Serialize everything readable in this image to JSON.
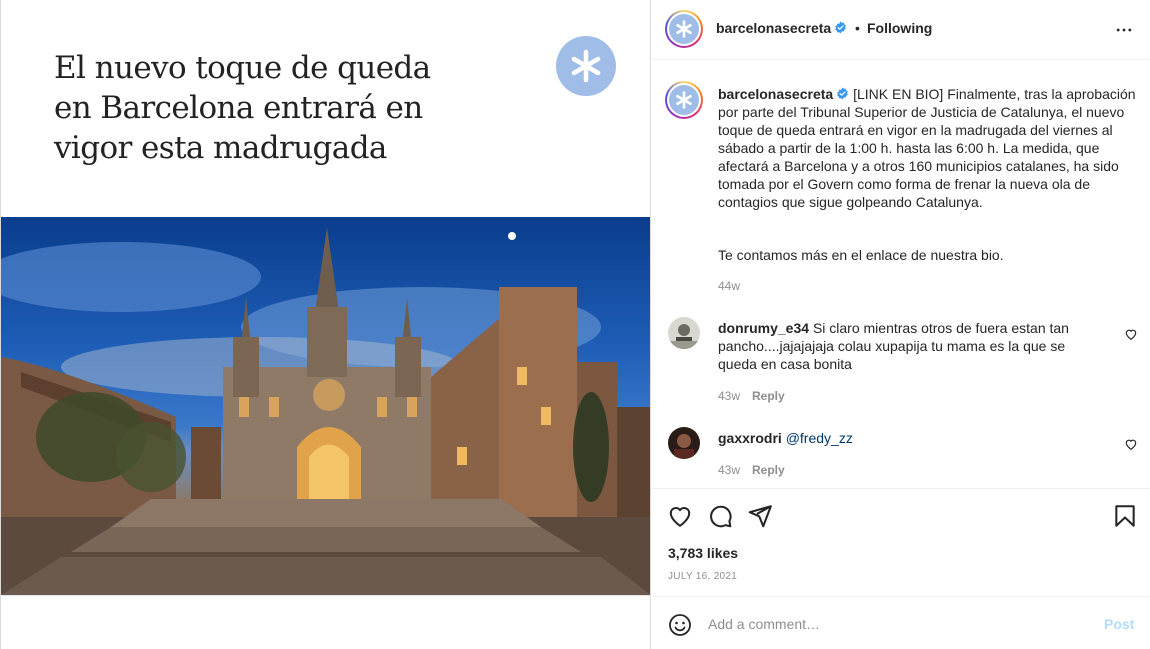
{
  "media": {
    "headline_lines": [
      "El nuevo toque de queda",
      "en Barcelona entrará en",
      "vigor esta madrugada"
    ],
    "logo_icon": "asterisk-logo-icon",
    "photo_subject": "cathedral-photo"
  },
  "post": {
    "author": "barcelonasecreta",
    "verified": true,
    "follow_separator": "•",
    "follow_status": "Following",
    "more_icon": "more-options-icon"
  },
  "caption": {
    "author": "barcelonasecreta",
    "text": "[LINK EN BIO] Finalmente, tras la aprobación por parte del Tribunal Superior de Justicia de Catalunya, el nuevo toque de queda entrará en vigor en la madrugada del viernes al sábado a partir de la 1:00 h. hasta las 6:00 h. La medida, que afectará a Barcelona y a otros 160 municipios catalanes, ha sido tomada por el Govern como forma de frenar la nueva ola de contagios que sigue golpeando Catalunya.",
    "extra": "Te contamos más en el enlace de nuestra bio.",
    "time": "44w"
  },
  "comments": [
    {
      "author": "donrumy_e34",
      "text": "Si claro mientras otros de fuera estan tan pancho....jajajajaja colau xupapija tu mama es la que se queda en casa bonita",
      "time": "43w",
      "reply_label": "Reply"
    },
    {
      "author": "gaxxrodri",
      "mention": "@fredy_zz",
      "time": "43w",
      "reply_label": "Reply"
    }
  ],
  "actions": {
    "icons": [
      "heart-icon",
      "comment-icon",
      "share-icon",
      "bookmark-icon"
    ],
    "likes": "3,783 likes",
    "date": "JULY 16, 2021"
  },
  "add_comment": {
    "placeholder": "Add a comment…",
    "post_label": "Post",
    "emoji_icon": "emoji-icon"
  },
  "colors": {
    "brand_avatar": "#9fbde6",
    "verified": "#3897f0",
    "post_button_disabled": "#b3dbff",
    "mention": "#00376b"
  }
}
